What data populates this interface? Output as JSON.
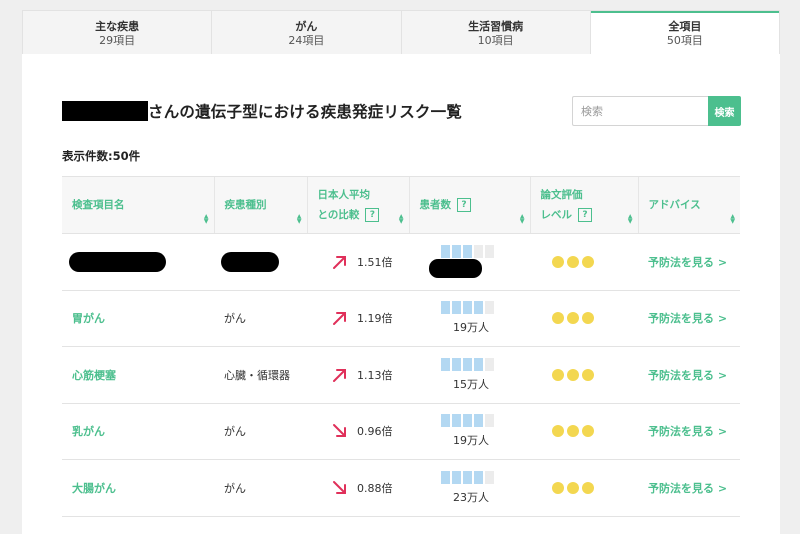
{
  "tabs": [
    {
      "label": "主な疾患",
      "count": "29項目",
      "active": false
    },
    {
      "label": "がん",
      "count": "24項目",
      "active": false
    },
    {
      "label": "生活習慣病",
      "count": "10項目",
      "active": false
    },
    {
      "label": "全項目",
      "count": "50項目",
      "active": true
    }
  ],
  "page": {
    "title": "さんの遺伝子型における疾患発症リスク一覧",
    "count_label": "表示件数:50件"
  },
  "search": {
    "placeholder": "検索",
    "button_label": "検索"
  },
  "table": {
    "headers": {
      "name": "検査項目名",
      "category": "疾患種別",
      "ratio_line1": "日本人平均",
      "ratio_line2": "との比較",
      "patients": "患者数",
      "eval_line1": "論文評価",
      "eval_line2": "レベル",
      "advice": "アドバイス",
      "help": "?"
    },
    "rows": [
      {
        "name": "",
        "category": "",
        "ratio": "1.51倍",
        "trend": "up",
        "patients": "",
        "bars": 3,
        "stars": 3,
        "advice": "予防法を見る >"
      },
      {
        "name": "胃がん",
        "category": "がん",
        "ratio": "1.19倍",
        "trend": "up",
        "patients": "19万人",
        "bars": 4,
        "stars": 3,
        "advice": "予防法を見る >"
      },
      {
        "name": "心筋梗塞",
        "category": "心臓・循環器",
        "ratio": "1.13倍",
        "trend": "up",
        "patients": "15万人",
        "bars": 4,
        "stars": 3,
        "advice": "予防法を見る >"
      },
      {
        "name": "乳がん",
        "category": "がん",
        "ratio": "0.96倍",
        "trend": "down",
        "patients": "19万人",
        "bars": 4,
        "stars": 3,
        "advice": "予防法を見る >"
      },
      {
        "name": "大腸がん",
        "category": "がん",
        "ratio": "0.88倍",
        "trend": "down",
        "patients": "23万人",
        "bars": 4,
        "stars": 3,
        "advice": "予防法を見る >"
      }
    ]
  },
  "colors": {
    "accent": "#4cbf8e",
    "arrow": "#e0305a",
    "bar_on": "#b3d8f2",
    "bar_off": "#ececec",
    "dot": "#f3d750"
  }
}
